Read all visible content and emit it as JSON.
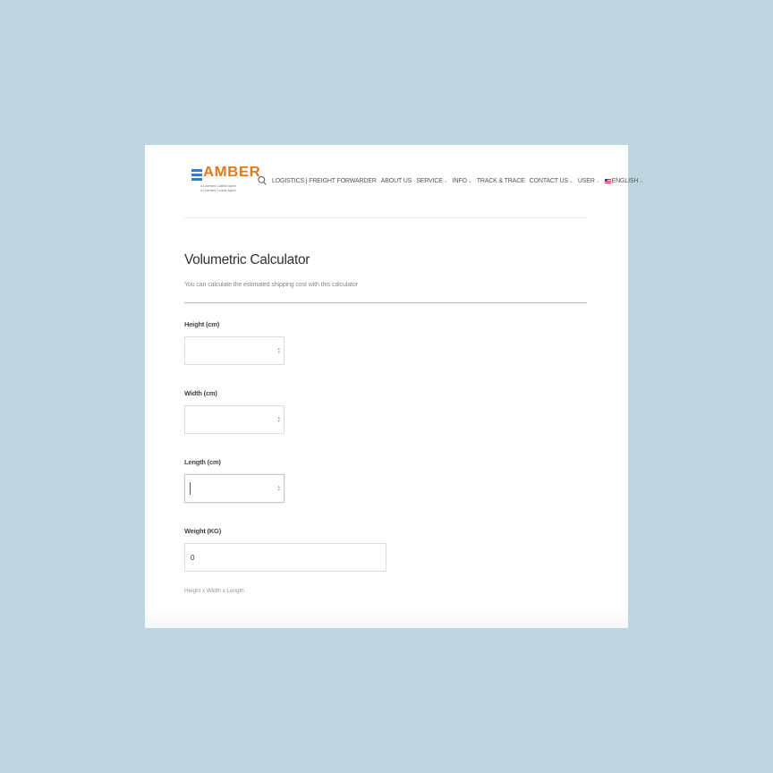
{
  "logo": {
    "word": "AMBER",
    "line1": "A Licensed Custom Agent",
    "line2": "A Licensed Courier Agent",
    "color": "#e07b1a",
    "mark_color": "#2b7fd0"
  },
  "nav": {
    "search_icon": "search-icon",
    "items": [
      {
        "label": "LOGISTICS | FREIGHT FORWARDER",
        "dropdown": false
      },
      {
        "label": "ABOUT US",
        "dropdown": false
      },
      {
        "label": "SERVICE",
        "dropdown": true
      },
      {
        "label": "INFO",
        "dropdown": true
      },
      {
        "label": "TRACK & TRACE",
        "dropdown": false
      },
      {
        "label": "CONTACT US",
        "dropdown": true
      },
      {
        "label": "USER",
        "dropdown": true
      },
      {
        "label": "ENGLISH",
        "dropdown": true,
        "flag": "us-flag-icon"
      }
    ]
  },
  "page": {
    "title": "Volumetric Calculator",
    "subtitle": "You can calculate the estimated shipping cost with this calculator"
  },
  "form": {
    "height_label": "Height (cm)",
    "height_value": "",
    "width_label": "Width (cm)",
    "width_value": "",
    "length_label": "Length (cm)",
    "length_value": "",
    "weight_label": "Weight (KG)",
    "weight_value": "0",
    "hint": "Height x Width x Length"
  },
  "colors": {
    "background": "#bdd5dd",
    "card": "#ffffff"
  }
}
